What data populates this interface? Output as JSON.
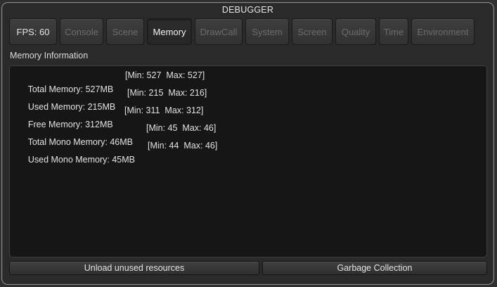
{
  "window": {
    "title": "DEBUGGER"
  },
  "tabs": [
    {
      "label": "FPS: 60",
      "enabled": true,
      "active": false
    },
    {
      "label": "Console",
      "enabled": false,
      "active": false
    },
    {
      "label": "Scene",
      "enabled": false,
      "active": false
    },
    {
      "label": "Memory",
      "enabled": true,
      "active": true
    },
    {
      "label": "DrawCall",
      "enabled": false,
      "active": false
    },
    {
      "label": "System",
      "enabled": false,
      "active": false
    },
    {
      "label": "Screen",
      "enabled": false,
      "active": false
    },
    {
      "label": "Quality",
      "enabled": false,
      "active": false
    },
    {
      "label": "Time",
      "enabled": false,
      "active": false
    },
    {
      "label": "Environment",
      "enabled": false,
      "active": false
    }
  ],
  "memory": {
    "section_label": "Memory Information",
    "rows": [
      {
        "label": "Total Memory: 527MB",
        "stats": "[Min: 527  Max: 527]"
      },
      {
        "label": "Used Memory: 215MB",
        "stats": "[Min: 215  Max: 216]"
      },
      {
        "label": "Free Memory: 312MB",
        "stats": "[Min: 311  Max: 312]"
      },
      {
        "label": "Total Mono Memory: 46MB",
        "stats": "[Min: 45  Max: 46]"
      },
      {
        "label": "Used Mono Memory: 45MB",
        "stats": "[Min: 44  Max: 46]"
      }
    ]
  },
  "actions": {
    "unload_label": "Unload unused resources",
    "gc_label": "Garbage Collection"
  },
  "colors": {
    "enabled_text": "#e4e4e4",
    "disabled_text": "#6c6c6c",
    "panel_background": "#161616"
  }
}
